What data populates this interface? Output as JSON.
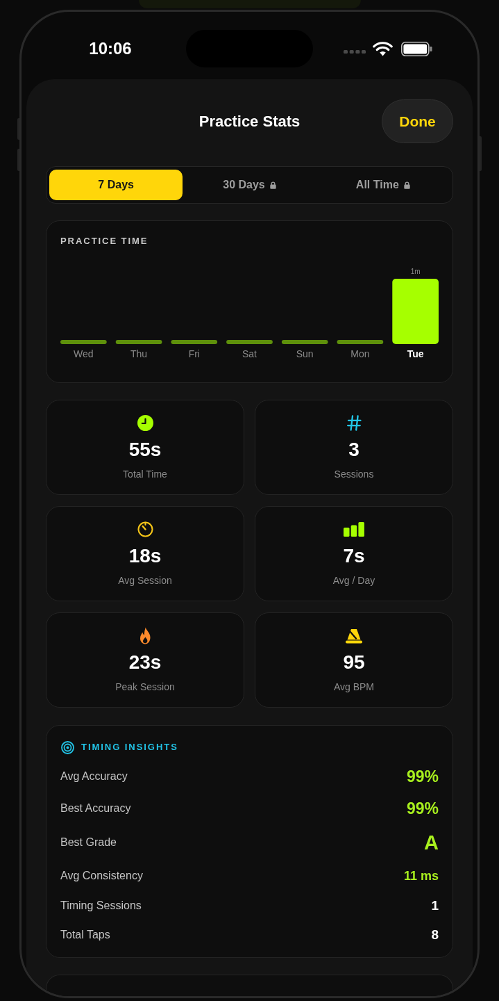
{
  "status_bar": {
    "time": "10:06"
  },
  "sheet": {
    "title": "Practice Stats",
    "done_button": "Done"
  },
  "tabs": [
    {
      "label": "7 Days",
      "selected": true,
      "locked": false
    },
    {
      "label": "30 Days",
      "selected": false,
      "locked": true
    },
    {
      "label": "All Time",
      "selected": false,
      "locked": true
    }
  ],
  "practice_time": {
    "title": "PRACTICE TIME",
    "days": [
      {
        "label": "Wed",
        "kind": "idle",
        "today": false
      },
      {
        "label": "Thu",
        "kind": "idle",
        "today": false
      },
      {
        "label": "Fri",
        "kind": "idle",
        "today": false
      },
      {
        "label": "Sat",
        "kind": "idle",
        "today": false
      },
      {
        "label": "Sun",
        "kind": "idle",
        "today": false
      },
      {
        "label": "Mon",
        "kind": "idle",
        "today": false
      },
      {
        "label": "Tue",
        "kind": "active",
        "value": "1m",
        "today": true
      }
    ]
  },
  "stats": [
    {
      "kind": "clock",
      "color": "#a6ff00",
      "value": "55s",
      "label": "Total Time"
    },
    {
      "kind": "hash",
      "color": "#22c7e8",
      "value": "3",
      "label": "Sessions"
    },
    {
      "kind": "timer",
      "color": "#f5c518",
      "value": "18s",
      "label": "Avg Session"
    },
    {
      "kind": "bars",
      "color": "#a6ff00",
      "value": "7s",
      "label": "Avg / Day"
    },
    {
      "kind": "flame",
      "color": "#ff8a2b",
      "value": "23s",
      "label": "Peak Session"
    },
    {
      "kind": "metronome",
      "color": "#ffd60a",
      "value": "95",
      "label": "Avg BPM"
    }
  ],
  "timing_insights": {
    "title": "TIMING INSIGHTS",
    "rows": [
      {
        "kind": "percent",
        "label": "Avg Accuracy",
        "value": "99%"
      },
      {
        "kind": "percent",
        "label": "Best Accuracy",
        "value": "99%"
      },
      {
        "kind": "grade",
        "label": "Best Grade",
        "value": "A"
      },
      {
        "kind": "duration",
        "label": "Avg Consistency",
        "value": "11 ms"
      },
      {
        "kind": "count",
        "label": "Timing Sessions",
        "value": "1"
      },
      {
        "kind": "count",
        "label": "Total Taps",
        "value": "8"
      }
    ]
  }
}
